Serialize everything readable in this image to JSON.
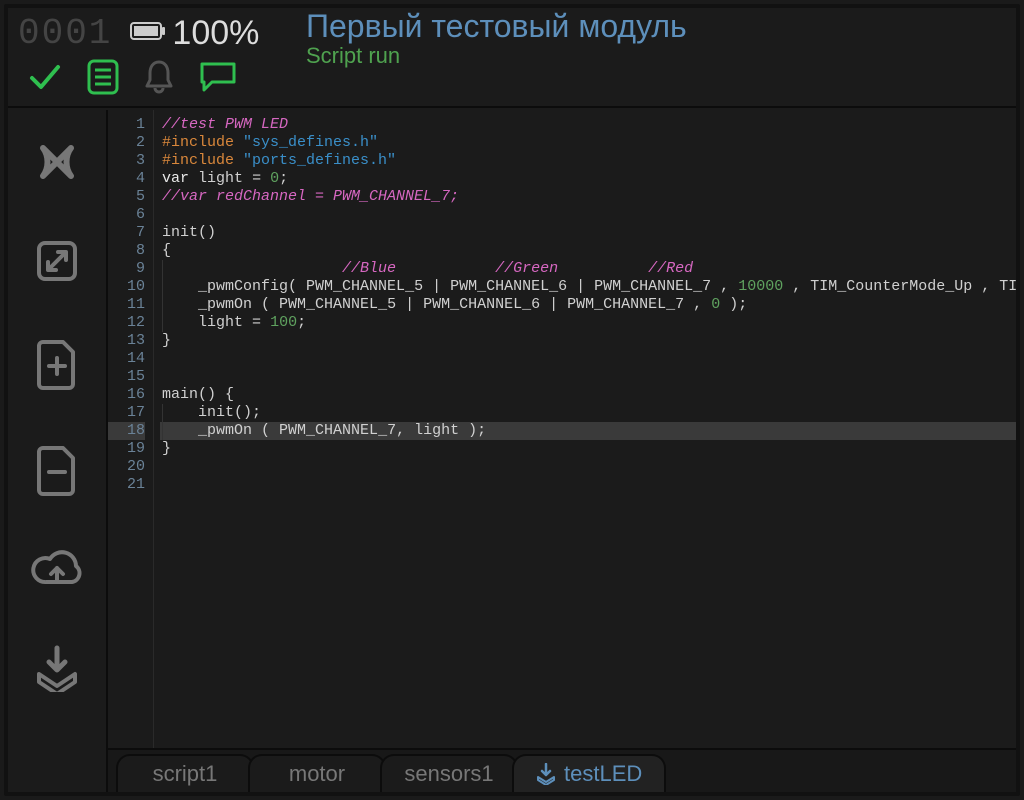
{
  "status": {
    "counter": "0001",
    "battery_percent": "100%"
  },
  "title": {
    "main": "Первый тестовый модуль",
    "sub": "Script run"
  },
  "editor": {
    "highlighted_line": 18,
    "line_count": 21,
    "lines": [
      {
        "tokens": [
          {
            "cls": "c-comment",
            "t": "//test PWM LED"
          }
        ]
      },
      {
        "tokens": [
          {
            "cls": "c-pre",
            "t": "#include"
          },
          {
            "cls": "",
            "t": " "
          },
          {
            "cls": "c-str",
            "t": "\"sys_defines.h\""
          }
        ]
      },
      {
        "tokens": [
          {
            "cls": "c-pre",
            "t": "#include"
          },
          {
            "cls": "",
            "t": " "
          },
          {
            "cls": "c-str",
            "t": "\"ports_defines.h\""
          }
        ]
      },
      {
        "tokens": [
          {
            "cls": "c-kw",
            "t": "var"
          },
          {
            "cls": "",
            "t": " "
          },
          {
            "cls": "c-id",
            "t": "light"
          },
          {
            "cls": "",
            "t": " "
          },
          {
            "cls": "c-op",
            "t": "="
          },
          {
            "cls": "",
            "t": " "
          },
          {
            "cls": "c-num",
            "t": "0"
          },
          {
            "cls": "c-op",
            "t": ";"
          }
        ]
      },
      {
        "tokens": [
          {
            "cls": "c-comment",
            "t": "//var redChannel = PWM_CHANNEL_7;"
          }
        ]
      },
      {
        "tokens": []
      },
      {
        "tokens": [
          {
            "cls": "c-id",
            "t": "init"
          },
          {
            "cls": "c-op",
            "t": "()"
          }
        ]
      },
      {
        "tokens": [
          {
            "cls": "c-op",
            "t": "{"
          }
        ]
      },
      {
        "indent": 1,
        "tokens": [
          {
            "cls": "",
            "t": "                "
          },
          {
            "cls": "c-comment",
            "t": "//Blue"
          },
          {
            "cls": "",
            "t": "           "
          },
          {
            "cls": "c-comment",
            "t": "//Green"
          },
          {
            "cls": "",
            "t": "          "
          },
          {
            "cls": "c-comment",
            "t": "//Red"
          }
        ]
      },
      {
        "indent": 1,
        "tokens": [
          {
            "cls": "c-id",
            "t": "_pwmConfig"
          },
          {
            "cls": "c-op",
            "t": "( "
          },
          {
            "cls": "c-id",
            "t": "PWM_CHANNEL_5"
          },
          {
            "cls": "c-op",
            "t": " | "
          },
          {
            "cls": "c-id",
            "t": "PWM_CHANNEL_6"
          },
          {
            "cls": "c-op",
            "t": " | "
          },
          {
            "cls": "c-id",
            "t": "PWM_CHANNEL_7"
          },
          {
            "cls": "c-op",
            "t": " , "
          },
          {
            "cls": "c-num",
            "t": "10000"
          },
          {
            "cls": "c-op",
            "t": " , "
          },
          {
            "cls": "c-id",
            "t": "TIM_CounterMode_Up"
          },
          {
            "cls": "c-op",
            "t": " , "
          },
          {
            "cls": "c-id",
            "t": "TIM_OCPolarity_High"
          },
          {
            "cls": "c-op",
            "t": " );"
          }
        ]
      },
      {
        "indent": 1,
        "tokens": [
          {
            "cls": "c-id",
            "t": "_pwmOn"
          },
          {
            "cls": "c-op",
            "t": " ( "
          },
          {
            "cls": "c-id",
            "t": "PWM_CHANNEL_5"
          },
          {
            "cls": "c-op",
            "t": " | "
          },
          {
            "cls": "c-id",
            "t": "PWM_CHANNEL_6"
          },
          {
            "cls": "c-op",
            "t": " | "
          },
          {
            "cls": "c-id",
            "t": "PWM_CHANNEL_7"
          },
          {
            "cls": "c-op",
            "t": " , "
          },
          {
            "cls": "c-num",
            "t": "0"
          },
          {
            "cls": "c-op",
            "t": " );"
          }
        ]
      },
      {
        "indent": 1,
        "tokens": [
          {
            "cls": "c-id",
            "t": "light"
          },
          {
            "cls": "",
            "t": " "
          },
          {
            "cls": "c-op",
            "t": "="
          },
          {
            "cls": "",
            "t": " "
          },
          {
            "cls": "c-num",
            "t": "100"
          },
          {
            "cls": "c-op",
            "t": ";"
          }
        ]
      },
      {
        "tokens": [
          {
            "cls": "c-op",
            "t": "}"
          }
        ]
      },
      {
        "tokens": []
      },
      {
        "tokens": []
      },
      {
        "tokens": [
          {
            "cls": "c-id",
            "t": "main"
          },
          {
            "cls": "c-op",
            "t": "() {"
          }
        ]
      },
      {
        "indent": 1,
        "tokens": [
          {
            "cls": "c-id",
            "t": "init"
          },
          {
            "cls": "c-op",
            "t": "();"
          }
        ]
      },
      {
        "indent": 1,
        "tokens": [
          {
            "cls": "c-id",
            "t": "_pwmOn"
          },
          {
            "cls": "c-op",
            "t": " ( "
          },
          {
            "cls": "c-id",
            "t": "PWM_CHANNEL_7"
          },
          {
            "cls": "c-op",
            "t": ", "
          },
          {
            "cls": "c-id",
            "t": "light"
          },
          {
            "cls": "c-op",
            "t": " );"
          }
        ]
      },
      {
        "tokens": [
          {
            "cls": "c-op",
            "t": "}"
          }
        ]
      },
      {
        "tokens": []
      },
      {
        "tokens": []
      }
    ]
  },
  "tabs": [
    {
      "label": "script1",
      "active": false,
      "icon": null
    },
    {
      "label": "motor",
      "active": false,
      "icon": null
    },
    {
      "label": "sensors1",
      "active": false,
      "icon": null
    },
    {
      "label": "testLED",
      "active": true,
      "icon": "download"
    }
  ]
}
